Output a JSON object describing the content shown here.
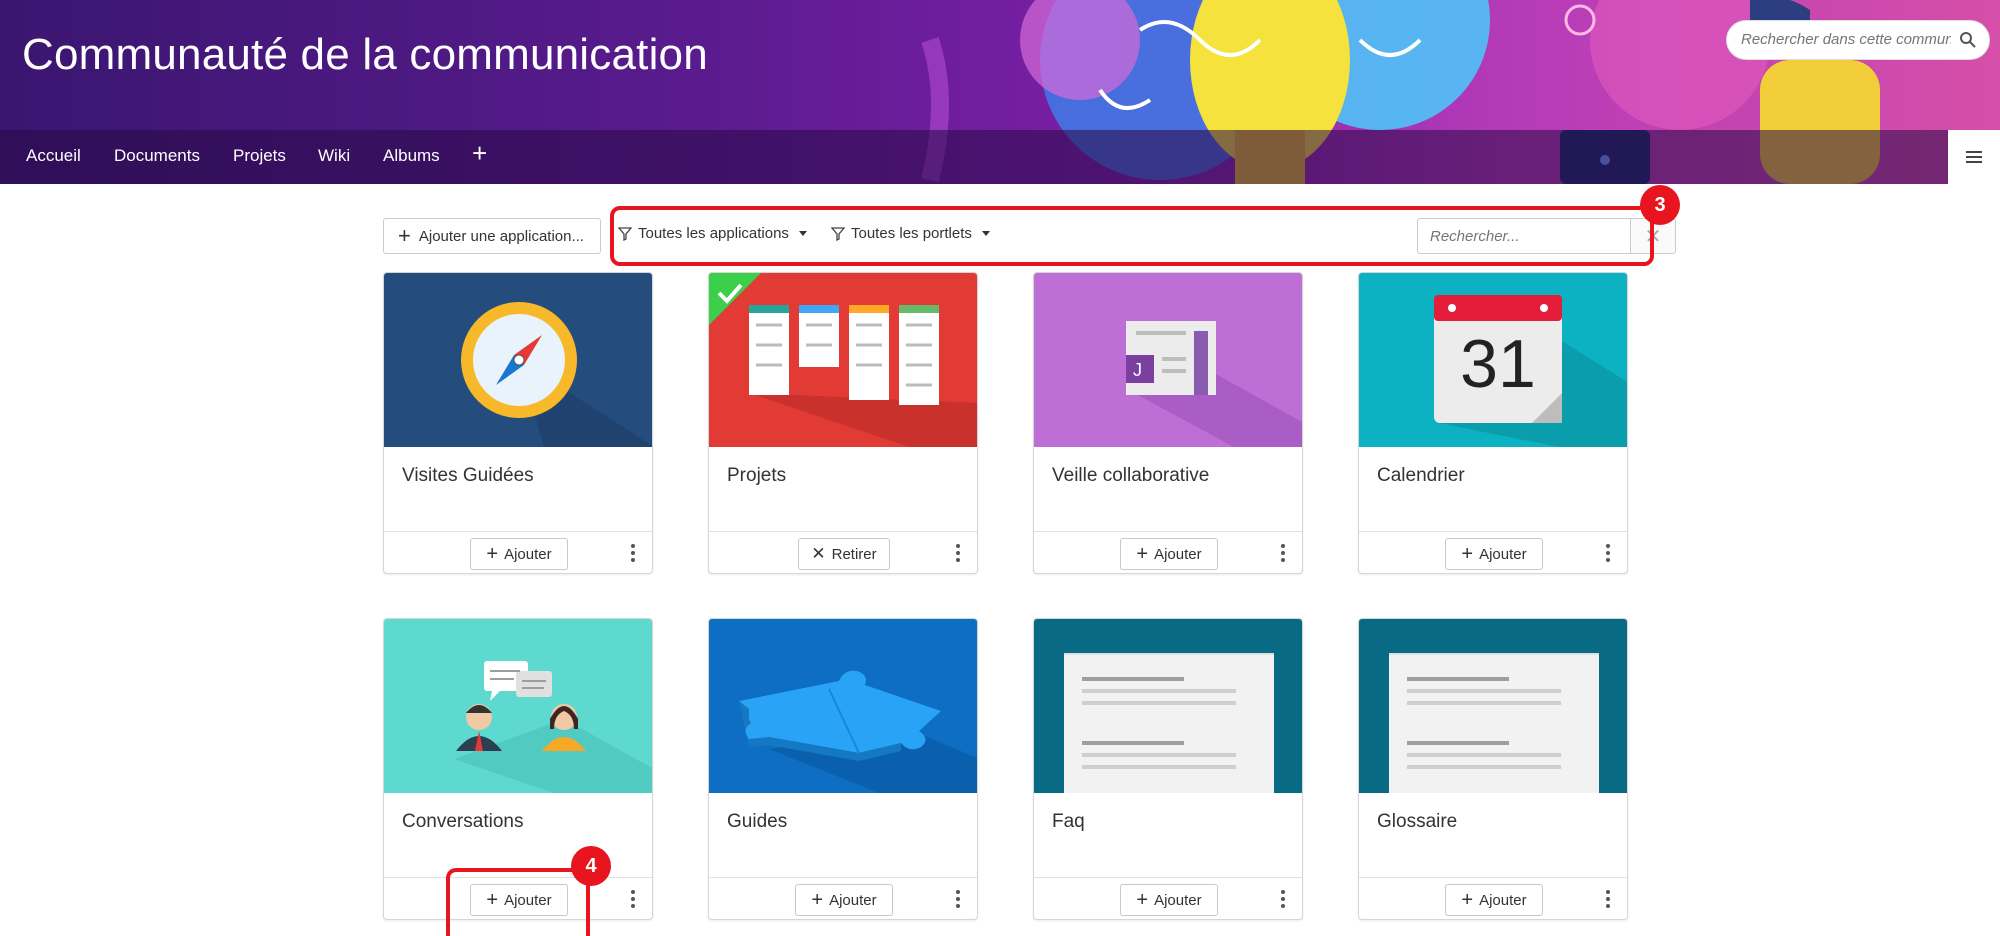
{
  "header": {
    "title": "Communauté de la communication",
    "search_placeholder": "Rechercher dans cette commun",
    "nav": [
      "Accueil",
      "Documents",
      "Projets",
      "Wiki",
      "Albums"
    ],
    "nav_add": "+"
  },
  "toolbar": {
    "add_app_label": "Ajouter une application...",
    "filter_apps": "Toutes les applications",
    "filter_portlets": "Toutes les portlets",
    "search_placeholder": "Rechercher...",
    "clear": "✕"
  },
  "annotations": {
    "box3": "3",
    "box4": "4"
  },
  "cards": [
    {
      "title": "Visites Guidées",
      "action": "Ajouter",
      "color": "#244c7c",
      "icon": "compass-icon"
    },
    {
      "title": "Projets",
      "action": "Retirer",
      "color": "#e23b36",
      "icon": "kanban-icon",
      "installed": true
    },
    {
      "title": "Veille collaborative",
      "action": "Ajouter",
      "color": "#bd6fd6",
      "icon": "newspaper-icon"
    },
    {
      "title": "Calendrier",
      "action": "Ajouter",
      "color": "#0cb2c2",
      "icon": "calendar-icon",
      "calendar_day": "31"
    },
    {
      "title": "Conversations",
      "action": "Ajouter",
      "color": "#5ed9d0",
      "icon": "conversation-icon"
    },
    {
      "title": "Guides",
      "action": "Ajouter",
      "color": "#0d6ec3",
      "icon": "puzzle-icon"
    },
    {
      "title": "Faq",
      "action": "Ajouter",
      "color": "#096a86",
      "icon": "document-icon"
    },
    {
      "title": "Glossaire",
      "action": "Ajouter",
      "color": "#096a86",
      "icon": "document-icon"
    }
  ]
}
